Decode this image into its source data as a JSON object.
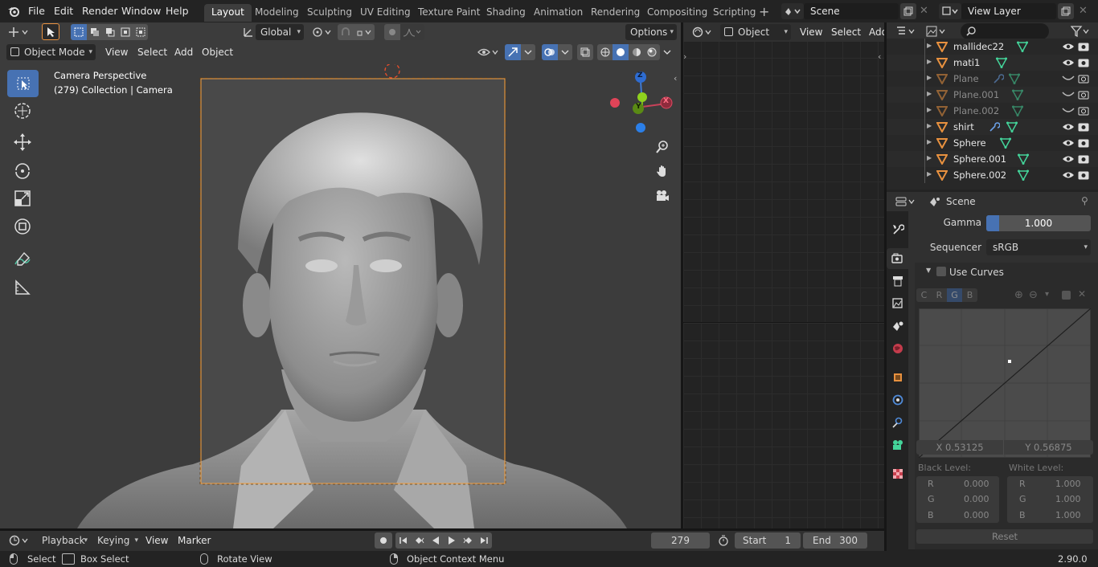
{
  "menu": {
    "items": [
      "File",
      "Edit",
      "Render",
      "Window",
      "Help"
    ]
  },
  "workspaces": [
    "Layout",
    "Modeling",
    "Sculpting",
    "UV Editing",
    "Texture Paint",
    "Shading",
    "Animation",
    "Rendering",
    "Compositing",
    "Scripting"
  ],
  "scene_name": "Scene",
  "view_layer_name": "View Layer",
  "viewport": {
    "orientation": "Global",
    "options": "Options",
    "mode": "Object Mode",
    "menus": [
      "View",
      "Select",
      "Add",
      "Object"
    ],
    "overlay_line1": "Camera Perspective",
    "overlay_line2": "(279) Collection | Camera",
    "gizmo": {
      "z": "Z",
      "y": "Y",
      "x": "X"
    }
  },
  "node_editor": {
    "mode": "Object",
    "menus": [
      "View",
      "Select",
      "Add"
    ]
  },
  "outliner": {
    "search_placeholder": "",
    "items": [
      {
        "name": "mallidec22",
        "dim": false
      },
      {
        "name": "mati1",
        "dim": false
      },
      {
        "name": "Plane",
        "dim": true
      },
      {
        "name": "Plane.001",
        "dim": true
      },
      {
        "name": "Plane.002",
        "dim": true
      },
      {
        "name": "shirt",
        "dim": false
      },
      {
        "name": "Sphere",
        "dim": false
      },
      {
        "name": "Sphere.001",
        "dim": false
      },
      {
        "name": "Sphere.002",
        "dim": false
      }
    ]
  },
  "properties": {
    "context": "Scene",
    "gamma_label": "Gamma",
    "gamma_value": "1.000",
    "gamma_fraction": 0.12,
    "sequencer_label": "Sequencer",
    "sequencer_value": "sRGB",
    "use_curves_label": "Use Curves",
    "channels": [
      "C",
      "R",
      "G",
      "B"
    ],
    "active_channel": "G",
    "curve_x": "X 0.53125",
    "curve_y": "Y 0.56875",
    "black_level_label": "Black Level:",
    "white_level_label": "White Level:",
    "black": [
      {
        "ch": "R",
        "v": "0.000"
      },
      {
        "ch": "G",
        "v": "0.000"
      },
      {
        "ch": "B",
        "v": "0.000"
      }
    ],
    "white": [
      {
        "ch": "R",
        "v": "1.000"
      },
      {
        "ch": "G",
        "v": "1.000"
      },
      {
        "ch": "B",
        "v": "1.000"
      }
    ],
    "reset": "Reset"
  },
  "timeline": {
    "menus": [
      "Playback",
      "Keying",
      "View",
      "Marker"
    ],
    "frame": "279",
    "start_label": "Start",
    "start": "1",
    "end_label": "End",
    "end": "300"
  },
  "status": {
    "select": "Select",
    "box_select": "Box Select",
    "rotate": "Rotate View",
    "context_menu": "Object Context Menu",
    "version": "2.90.0"
  },
  "colors": {
    "accent": "#4772b3",
    "orange": "#e8913f",
    "green_icon": "#44d49a",
    "camera_frame": "#f5a142"
  }
}
